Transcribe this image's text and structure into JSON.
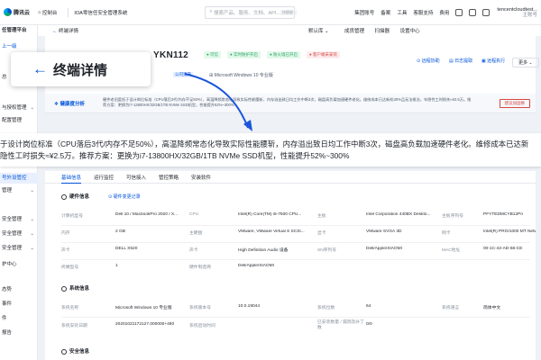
{
  "topbar": {
    "logo": "腾讯云",
    "console": "控制台",
    "product": "IOA零信任安全管理系统",
    "search_placeholder": "搜索产品、服务、文档、API...",
    "shortcut": "快捷键 /",
    "menu": [
      "集团账号",
      "备案",
      "工具",
      "客服支持",
      "费用"
    ],
    "user_name": "tencentcloudtest...",
    "user_role": "主账号"
  },
  "sidebar": {
    "items": [
      {
        "label": "任管理平台",
        "active": false
      },
      {
        "label": "上一级",
        "active": false
      },
      {
        "label": "总",
        "active": false
      },
      {
        "label": "与授权管理",
        "active": false
      },
      {
        "label": "配置管理",
        "active": false
      },
      {
        "label": "号外设管控",
        "active": true
      },
      {
        "label": "管理",
        "active": false
      },
      {
        "label": "安全管理",
        "active": false
      },
      {
        "label": "安全管理",
        "active": false
      },
      {
        "label": "安全管理",
        "active": false
      },
      {
        "label": "护中心",
        "active": false
      },
      {
        "label": "态势",
        "active": false
      },
      {
        "label": "事件",
        "active": false
      },
      {
        "label": "件",
        "active": false
      },
      {
        "label": "报告",
        "active": false
      }
    ]
  },
  "subhead": {
    "back_label": "终端详情",
    "region": "默认库",
    "links": [
      "成员管理",
      "扫描器",
      "设置中心"
    ]
  },
  "device": {
    "name_suffix": "YKN112",
    "tags": [
      {
        "label": "可信",
        "color": "green"
      },
      {
        "label": "实时防护开启",
        "color": "green"
      },
      {
        "label": "防火墙已开启",
        "color": "green"
      },
      {
        "label": "客户端未安装",
        "color": "red"
      }
    ],
    "actions": [
      "远程协助",
      "日志提取",
      "远程执行",
      "更多"
    ],
    "meta": [
      "公司资产",
      "Microsoft Windows 10 专业版"
    ]
  },
  "health": {
    "label": "健康度分析",
    "text": "硬件老旧度低于设计岗位标准（CPU落后3代/内存不足50%），高温降频常态化导致实际性能腰斩，内存溢出致日均工作中断3次，磁盘高负载加速硬件老化。维修成本已达新机30%且无法根治，年隐性工时损失≈¥2.5万。推荐方案：更换为i7-13800HX/32GB/1TB NVMe SSD机型，性能提升52%~300%",
    "button": "建议加固换"
  },
  "callout": {
    "title": "终端详情",
    "line1": "于设计岗位标准（CPU落后3代/内存不足50%），高温降频常态化导致实际性能腰斩，内存溢出致日均工作中断3次，磁盘高负载加速硬件老化。维修成本已达新",
    "line2": "隐性工时损失≈¥2.5万。推荐方案：更换为i7-13800HX/32GB/1TB NVMe SSD机型，性能提升52%~300%"
  },
  "tabs": [
    "基础信息",
    "运行监控",
    "可信接入",
    "管控策略",
    "安装软件"
  ],
  "hardware": {
    "title": "硬件信息",
    "link": "硬件变更记录",
    "rows": [
      [
        {
          "k": "计算机型号",
          "v": "Dell 10 / MacbookPro 2020 / X..."
        },
        {
          "k": "CPU",
          "v": "Intel(R) Core(TM) i5-7500 CPU..."
        },
        {
          "k": "主板",
          "v": "Intel Corporation 440BX Deskto..."
        },
        {
          "k": "主板序列号",
          "v": "PFYTEDMCYB12Pn"
        }
      ],
      [
        {
          "k": "内存",
          "v": "2 GB"
        },
        {
          "k": "主硬盘",
          "v": "VMware, VMware Virtual S SCSI..."
        },
        {
          "k": "显卡",
          "v": "VMware SVGA 3D"
        },
        {
          "k": "网卡",
          "v": "Intel(R) PRO/1000 MT Network"
        }
      ],
      [
        {
          "k": "声卡",
          "v": "DELL X520"
        },
        {
          "k": "声卡",
          "v": "High Definition Audio 设备"
        },
        {
          "k": "SN序列号",
          "v": "Dell/Apple/XIAOMI"
        },
        {
          "k": "MAC地址",
          "v": "00-1C-42-AD-66-CE"
        }
      ],
      [
        {
          "k": "终端型号",
          "v": "1"
        },
        {
          "k": "硬件制造商",
          "v": "Dell/Apple/XIAOMI"
        }
      ]
    ]
  },
  "system": {
    "title": "系统信息",
    "rows": [
      [
        {
          "k": "系统名称",
          "v": "Microsoft Windows 10 专业版"
        },
        {
          "k": "系统版本号",
          "v": "10.0.19044"
        },
        {
          "k": "系统位数",
          "v": "64"
        },
        {
          "k": "系统语言",
          "v": "简体中文"
        }
      ],
      [
        {
          "k": "系统安装日期",
          "v": "20201021172127.000000+480"
        },
        {
          "k": "系统启动时间",
          "v": ""
        },
        {
          "k": "已安装数量 / 漏洞及补丁数",
          "v": "0/0"
        }
      ]
    ]
  },
  "security": {
    "title": "安全信息"
  },
  "colors": {
    "brand": "#0052d9",
    "green": "#2ba471",
    "red": "#d54941"
  }
}
